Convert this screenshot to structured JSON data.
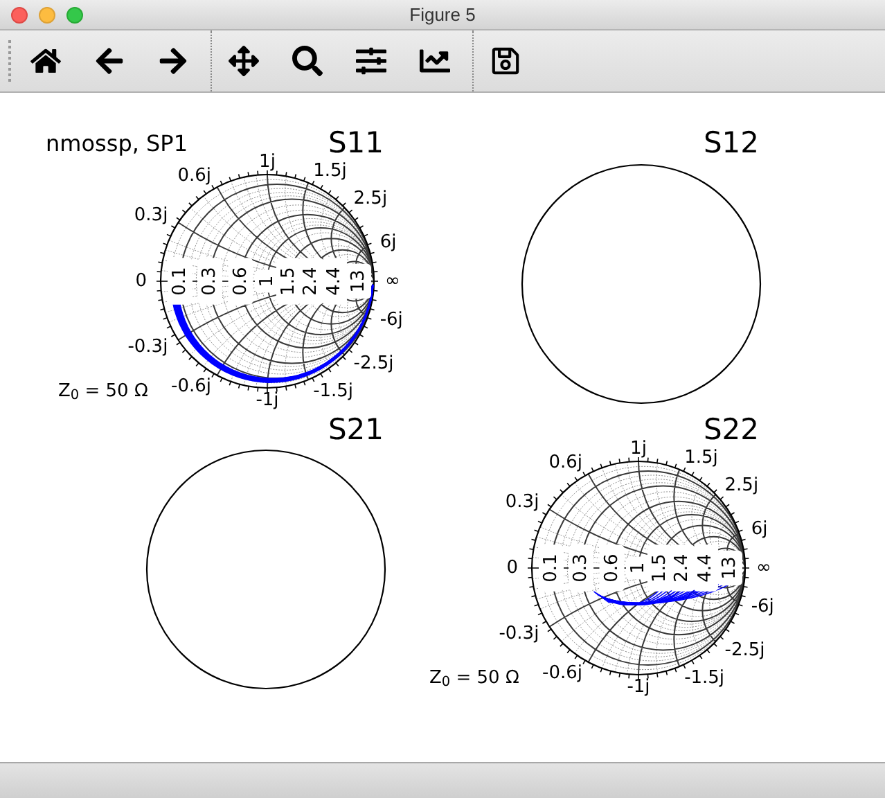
{
  "window": {
    "title": "Figure 5"
  },
  "figure": {
    "annotation": "nmossp, SP1",
    "plots": [
      {
        "title": "S11",
        "kind": "smith",
        "zero_label": "0",
        "infinity_label": "∞",
        "impedance_label": "Z$_{0}$ = 50 Ω",
        "resistance_labels": [
          "0.1",
          "0.3",
          "0.6",
          "1",
          "1.5",
          "2.4",
          "4.4",
          "13"
        ],
        "reactance_labels": [
          "0.3j",
          "0.6j",
          "1j",
          "1.5j",
          "2.5j",
          "6j",
          "-0.3j",
          "-0.6j",
          "-1j",
          "-1.5j",
          "-2.5j",
          "-6j"
        ]
      },
      {
        "title": "S12",
        "kind": "blank"
      },
      {
        "title": "S21",
        "kind": "blank"
      },
      {
        "title": "S22",
        "kind": "smith",
        "zero_label": "0",
        "infinity_label": "∞",
        "impedance_label": "Z$_{0}$ = 50 Ω",
        "resistance_labels": [
          "0.1",
          "0.3",
          "0.6",
          "1",
          "1.5",
          "2.4",
          "4.4",
          "13"
        ],
        "reactance_labels": [
          "0.3j",
          "0.6j",
          "1j",
          "1.5j",
          "2.5j",
          "6j",
          "-0.3j",
          "-0.6j",
          "-1j",
          "-1.5j",
          "-2.5j",
          "-6j"
        ]
      }
    ]
  }
}
